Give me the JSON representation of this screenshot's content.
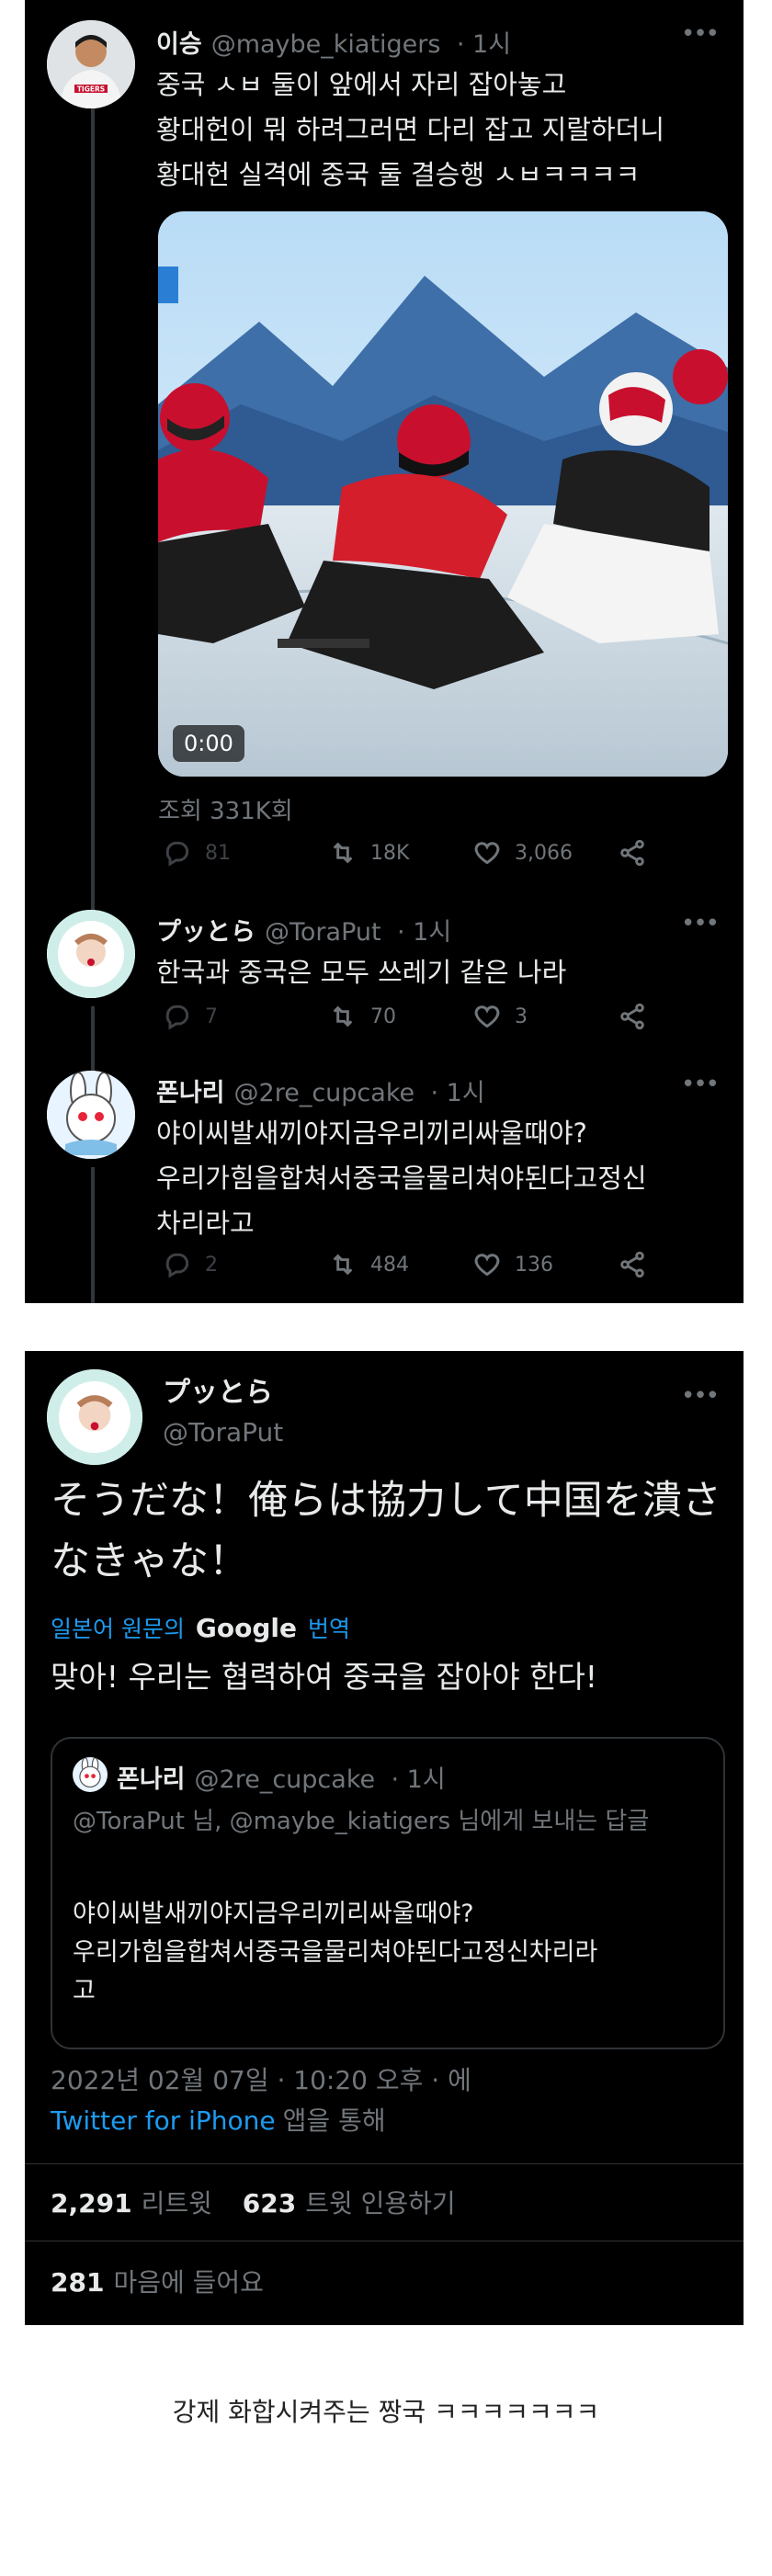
{
  "thread": [
    {
      "name": "이승",
      "handle": "@maybe_kiatigers",
      "time": "· 1시",
      "text": "중국 ㅅㅂ 둘이 앞에서 자리 잡아놓고\n황대헌이 뭐 하려그러면 다리 잡고 지랄하더니\n황대헌 실격에 중국 둘 결승행 ㅅㅂㅋㅋㅋㅋ",
      "video_time": "0:00",
      "views": "조회 331K회",
      "replies": "81",
      "retweets": "18K",
      "likes": "3,066",
      "avatar_badge": "TIGERS"
    },
    {
      "name": "プッとら",
      "handle": "@ToraPut",
      "time": "· 1시",
      "text": "한국과 중국은 모두 쓰레기 같은 나라",
      "replies": "7",
      "retweets": "70",
      "likes": "3"
    },
    {
      "name": "폰나리",
      "handle": "@2re_cupcake",
      "time": "· 1시",
      "text": "야이씨발새끼야지금우리끼리싸울때야?\n우리가힘을합쳐서중국을물리쳐야된다고정신\n차리라고",
      "replies": "2",
      "retweets": "484",
      "likes": "136"
    }
  ],
  "detail": {
    "name": "プッとら",
    "handle": "@ToraPut",
    "text": "そうだな！俺らは協力して中国を潰さなきゃな！",
    "translate_prefix": "일본어 원문의",
    "translate_brand": "Google",
    "translate_suffix": "번역",
    "translated": "맞아! 우리는 협력하여 중국을 잡아야 한다!",
    "quote": {
      "name": "폰나리",
      "handle": "@2re_cupcake",
      "time": "· 1시",
      "reply_to": "@ToraPut 님, @maybe_kiatigers 님에게 보내는 답글",
      "text": "야이씨발새끼야지금우리끼리싸울때야?\n우리가힘을합쳐서중국을물리쳐야된다고정신차리라\n고"
    },
    "timestamp": "2022년 02월 07일 · 10:20 오후 · 에",
    "source": "Twitter for iPhone",
    "source_suffix": "앱을 통해",
    "retweet_count": "2,291",
    "retweet_label": "리트윗",
    "quote_count": "623",
    "quote_label": "트윗 인용하기",
    "like_count": "281",
    "like_label": "마음에 들어요"
  },
  "caption": "강제 화합시켜주는 짱국 ㅋㅋㅋㅋㅋㅋㅋ",
  "colors": {
    "background": "#000000",
    "accent": "#1d9bf0",
    "muted": "#71767b"
  },
  "icons": [
    "reply-icon",
    "retweet-icon",
    "like-icon",
    "share-icon",
    "more-icon"
  ]
}
